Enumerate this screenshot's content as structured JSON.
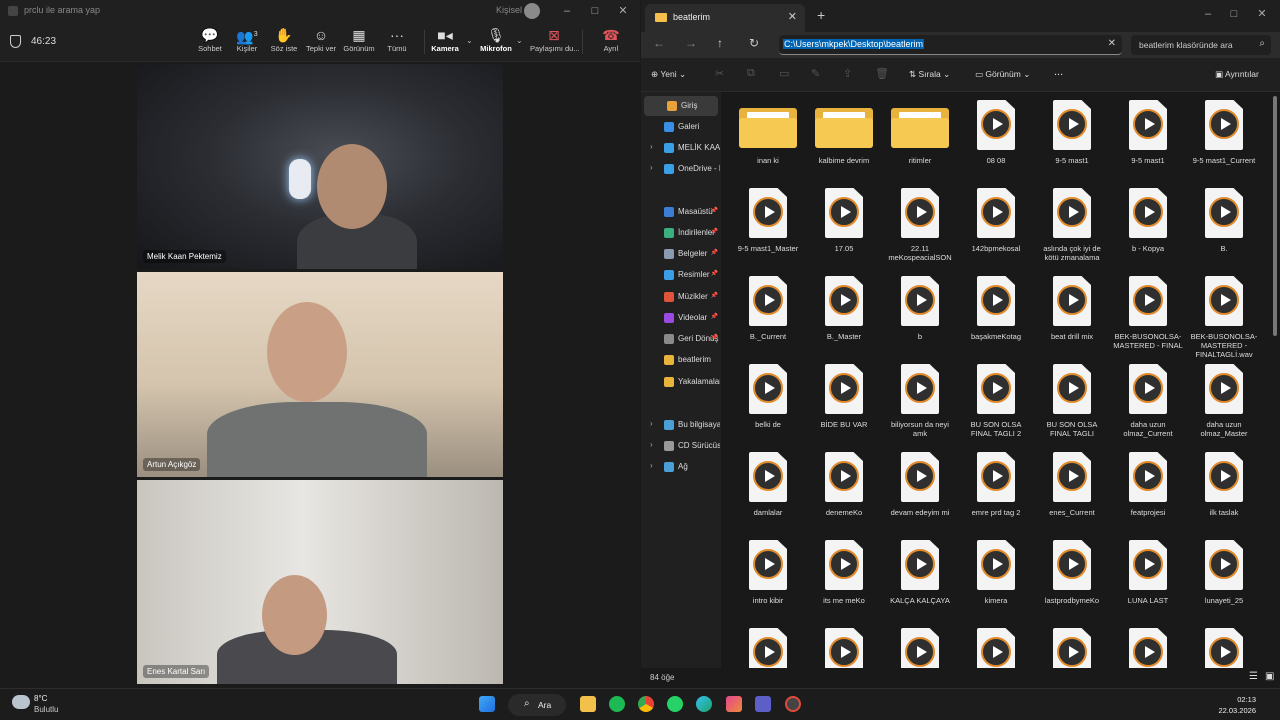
{
  "teams": {
    "title": "prclu ile arama yap",
    "account_label": "Kişisel",
    "timer": "46:23",
    "toolbar": [
      {
        "label": "Sohbet",
        "icon": "chat-icon"
      },
      {
        "label": "Kişiler",
        "icon": "people-icon",
        "badge": "3"
      },
      {
        "label": "Söz iste",
        "icon": "raise-hand-icon"
      },
      {
        "label": "Tepki ver",
        "icon": "react-icon"
      },
      {
        "label": "Görünüm",
        "icon": "view-icon"
      },
      {
        "label": "Tümü",
        "icon": "more-icon"
      },
      {
        "label": "Kamera",
        "icon": "camera-icon"
      },
      {
        "label": "Mikrofon",
        "icon": "mic-icon"
      },
      {
        "label": "Paylaşımı du...",
        "icon": "share-stop-icon"
      },
      {
        "label": "Ayrıl",
        "icon": "hang-up-icon"
      }
    ],
    "participants": [
      {
        "name": "Melik Kaan Pektemiz"
      },
      {
        "name": "Artun Açıkgöz"
      },
      {
        "name": "Enes Kartal Sarı"
      }
    ]
  },
  "explorer": {
    "tab_title": "beatlerim",
    "address": "C:\\Users\\mkpek\\Desktop\\beatlerim",
    "search_placeholder": "beatlerim klasöründe ara",
    "commands": {
      "new": "Yeni",
      "sort": "Sırala",
      "view": "Görünüm",
      "more": "...",
      "details": "Ayrıntılar"
    },
    "sidebar": [
      {
        "label": "Giriş",
        "selected": true,
        "color": "#e8a23a"
      },
      {
        "label": "Galeri",
        "color": "#3a8ee6"
      },
      {
        "label": "MELİK KAAN",
        "chev": true,
        "color": "#3aa0e6"
      },
      {
        "label": "OneDrive - P",
        "chev": true,
        "color": "#3aa0e6"
      },
      {
        "label": "Masaüstü",
        "pin": true,
        "color": "#3a7ed6"
      },
      {
        "label": "İndirilenler",
        "pin": true,
        "color": "#3ab07e"
      },
      {
        "label": "Belgeler",
        "pin": true,
        "color": "#8a9ab0"
      },
      {
        "label": "Resimler",
        "pin": true,
        "color": "#3a9ee6"
      },
      {
        "label": "Müzikler",
        "pin": true,
        "color": "#e0553a"
      },
      {
        "label": "Videolar",
        "pin": true,
        "color": "#9a4ae0"
      },
      {
        "label": "Geri Dönüş",
        "pin": true,
        "color": "#8a8a8a"
      },
      {
        "label": "beatlerim",
        "color": "#e8b43a"
      },
      {
        "label": "Yakalamalar",
        "color": "#e8b43a"
      },
      {
        "label": "Bu bilgisayar",
        "chev": true,
        "color": "#4aa0d6"
      },
      {
        "label": "CD Sürücüsü",
        "chev": true,
        "color": "#9a9a9a"
      },
      {
        "label": "Ağ",
        "chev": true,
        "color": "#4aa0d6"
      }
    ],
    "files": [
      {
        "name": "inan ki",
        "type": "folder"
      },
      {
        "name": "kalbime devrim",
        "type": "folder"
      },
      {
        "name": "ritimler",
        "type": "folder"
      },
      {
        "name": "08 08",
        "type": "audio"
      },
      {
        "name": "9-5 mast1",
        "type": "audio"
      },
      {
        "name": "9-5 mast1",
        "type": "audio"
      },
      {
        "name": "9-5 mast1_Current",
        "type": "audio"
      },
      {
        "name": "9-5 mast1_Master",
        "type": "audio"
      },
      {
        "name": "17.05",
        "type": "audio"
      },
      {
        "name": "22.11 meKospeacialSON",
        "type": "audio"
      },
      {
        "name": "142bpmekosal",
        "type": "audio"
      },
      {
        "name": "aslında çok iyi de kötü zmanalama",
        "type": "audio"
      },
      {
        "name": "b - Kopya",
        "type": "audio"
      },
      {
        "name": "B.",
        "type": "audio"
      },
      {
        "name": "B._Current",
        "type": "audio"
      },
      {
        "name": "B._Master",
        "type": "audio"
      },
      {
        "name": "b",
        "type": "audio"
      },
      {
        "name": "başakmeKotag",
        "type": "audio"
      },
      {
        "name": "beat drill mix",
        "type": "audio"
      },
      {
        "name": "BEK-BUSONOLSA-MASTERED - FINAL",
        "type": "audio"
      },
      {
        "name": "BEK-BUSONOLSA-MASTERED - FINALTAGLİ.wav",
        "type": "audio"
      },
      {
        "name": "belki de",
        "type": "audio"
      },
      {
        "name": "BİDE BU VAR",
        "type": "audio"
      },
      {
        "name": "biliyorsun da neyi amk",
        "type": "audio"
      },
      {
        "name": "BU SON OLSA FINAL TAGLI 2",
        "type": "audio"
      },
      {
        "name": "BU SON OLSA FINAL TAGLI",
        "type": "audio"
      },
      {
        "name": "daha uzun olmaz_Current",
        "type": "audio"
      },
      {
        "name": "daha uzun olmaz_Master",
        "type": "audio"
      },
      {
        "name": "damlalar",
        "type": "audio"
      },
      {
        "name": "denemeKo",
        "type": "audio"
      },
      {
        "name": "devam edeyim mi",
        "type": "audio"
      },
      {
        "name": "emre prd tag 2",
        "type": "audio"
      },
      {
        "name": "enes_Current",
        "type": "audio"
      },
      {
        "name": "featprojesi",
        "type": "audio"
      },
      {
        "name": "ilk taslak",
        "type": "audio"
      },
      {
        "name": "intro kibir",
        "type": "audio"
      },
      {
        "name": "its me meKo",
        "type": "audio"
      },
      {
        "name": "KALÇA KALÇAYA",
        "type": "audio"
      },
      {
        "name": "kimera",
        "type": "audio"
      },
      {
        "name": "lastprodbymeKo",
        "type": "audio"
      },
      {
        "name": "LUNA LAST",
        "type": "audio"
      },
      {
        "name": "lunayeti_25",
        "type": "audio"
      },
      {
        "name": "",
        "type": "audio"
      },
      {
        "name": "",
        "type": "audio"
      },
      {
        "name": "",
        "type": "audio"
      },
      {
        "name": "",
        "type": "audio"
      },
      {
        "name": "",
        "type": "audio"
      },
      {
        "name": "",
        "type": "audio"
      },
      {
        "name": "",
        "type": "audio"
      }
    ],
    "item_count": "84 öğe"
  },
  "taskbar": {
    "temperature": "8°C",
    "weather": "Bulutlu",
    "search_label": "Ara",
    "time": "02:13",
    "date": "22.03.2026"
  }
}
